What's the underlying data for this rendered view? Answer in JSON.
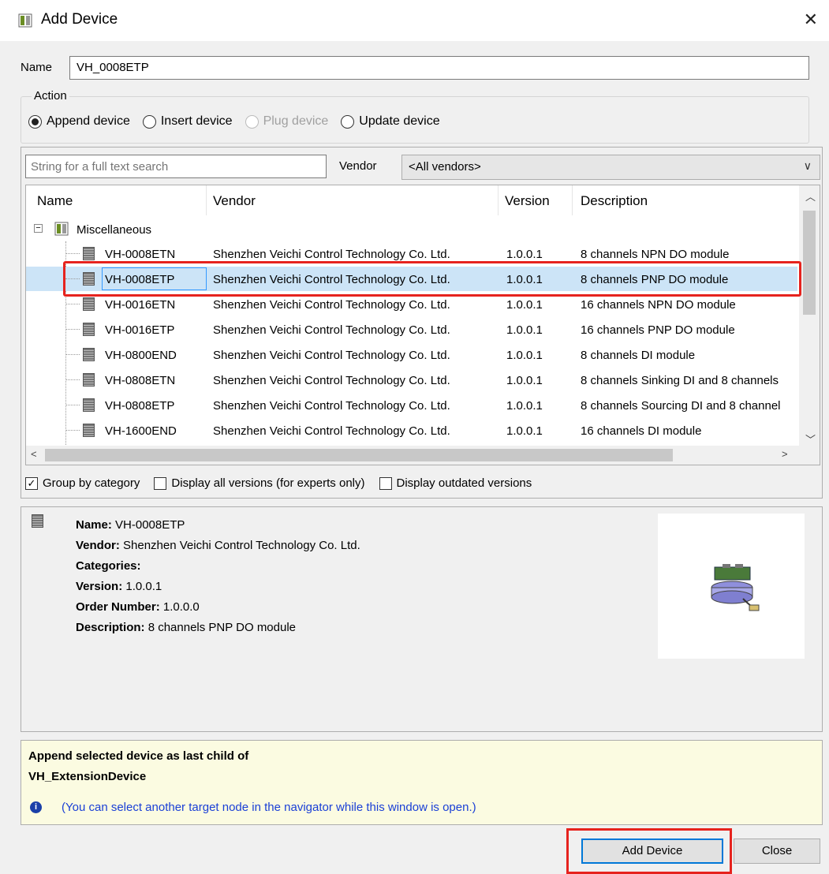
{
  "window": {
    "title": "Add Device",
    "close_glyph": "✕"
  },
  "name_field": {
    "label": "Name",
    "value": "VH_0008ETP"
  },
  "action": {
    "legend": "Action",
    "options": [
      {
        "label": "Append device",
        "checked": true,
        "disabled": false
      },
      {
        "label": "Insert device",
        "checked": false,
        "disabled": false
      },
      {
        "label": "Plug device",
        "checked": false,
        "disabled": true
      },
      {
        "label": "Update device",
        "checked": false,
        "disabled": false
      }
    ]
  },
  "search": {
    "placeholder": "String for a full text search",
    "vendor_label": "Vendor",
    "vendor_value": "<All vendors>"
  },
  "table": {
    "headers": [
      "Name",
      "Vendor",
      "Version",
      "Description"
    ],
    "category": "Miscellaneous",
    "rows": [
      {
        "name": "VH-0008ETN",
        "vendor": "Shenzhen Veichi Control Technology Co. Ltd.",
        "version": "1.0.0.1",
        "description": "8 channels NPN DO module"
      },
      {
        "name": "VH-0008ETP",
        "vendor": "Shenzhen Veichi Control Technology Co. Ltd.",
        "version": "1.0.0.1",
        "description": "8 channels PNP DO module"
      },
      {
        "name": "VH-0016ETN",
        "vendor": "Shenzhen Veichi Control Technology Co. Ltd.",
        "version": "1.0.0.1",
        "description": "16 channels NPN DO module"
      },
      {
        "name": "VH-0016ETP",
        "vendor": "Shenzhen Veichi Control Technology Co. Ltd.",
        "version": "1.0.0.1",
        "description": "16 channels PNP DO module"
      },
      {
        "name": "VH-0800END",
        "vendor": "Shenzhen Veichi Control Technology Co. Ltd.",
        "version": "1.0.0.1",
        "description": "8 channels DI module"
      },
      {
        "name": "VH-0808ETN",
        "vendor": "Shenzhen Veichi Control Technology Co. Ltd.",
        "version": "1.0.0.1",
        "description": "8 channels Sinking DI and 8 channels"
      },
      {
        "name": "VH-0808ETP",
        "vendor": "Shenzhen Veichi Control Technology Co. Ltd.",
        "version": "1.0.0.1",
        "description": "8 channels Sourcing DI and 8 channel"
      },
      {
        "name": "VH-1600END",
        "vendor": "Shenzhen Veichi Control Technology Co. Ltd.",
        "version": "1.0.0.1",
        "description": "16 channels DI module"
      }
    ],
    "selected_index": 1
  },
  "options": {
    "group_by_category": "Group by category",
    "display_all_versions": "Display all versions (for experts only)",
    "display_outdated": "Display outdated versions"
  },
  "info": {
    "name_key": "Name:",
    "name_val": "VH-0008ETP",
    "vendor_key": "Vendor:",
    "vendor_val": "Shenzhen Veichi Control Technology Co. Ltd.",
    "categories_key": "Categories:",
    "version_key": "Version:",
    "version_val": "1.0.0.1",
    "order_key": "Order Number:",
    "order_val": "1.0.0.0",
    "desc_key": "Description:",
    "desc_val": "8 channels PNP DO module"
  },
  "hint": {
    "title": "Append selected device as last child of",
    "target": "VH_ExtensionDevice",
    "note": "(You can select another target node in the navigator while this window is open.)",
    "info_glyph": "i"
  },
  "buttons": {
    "add": "Add Device",
    "close": "Close"
  },
  "colors": {
    "highlight": "#e6231e",
    "selection": "#cce4f7",
    "hint_text": "#1a3fd6"
  }
}
